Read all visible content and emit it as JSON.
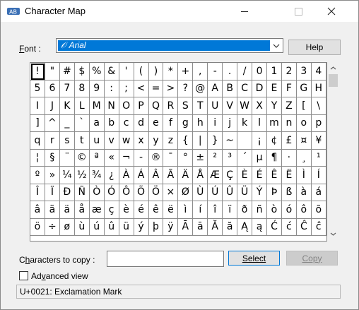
{
  "window": {
    "title": "Character Map",
    "buttons": [
      "minimize",
      "maximize",
      "close"
    ]
  },
  "font": {
    "label": "Font :",
    "selected": "Arial",
    "help_label": "Help"
  },
  "grid": {
    "selected_char": "!",
    "cells": [
      "!",
      "\"",
      "#",
      "$",
      "%",
      "&",
      "'",
      "(",
      ")",
      "*",
      "+",
      ",",
      "-",
      ".",
      "/",
      "0",
      "1",
      "2",
      "3",
      "4",
      "5",
      "6",
      "7",
      "8",
      "9",
      ":",
      ";",
      "<",
      "=",
      ">",
      "?",
      "@",
      "A",
      "B",
      "C",
      "D",
      "E",
      "F",
      "G",
      "H",
      "I",
      "J",
      "K",
      "L",
      "M",
      "N",
      "O",
      "P",
      "Q",
      "R",
      "S",
      "T",
      "U",
      "V",
      "W",
      "X",
      "Y",
      "Z",
      "[",
      "\\",
      "]",
      "^",
      "_",
      "`",
      "a",
      "b",
      "c",
      "d",
      "e",
      "f",
      "g",
      "h",
      "i",
      "j",
      "k",
      "l",
      "m",
      "n",
      "o",
      "p",
      "q",
      "r",
      "s",
      "t",
      "u",
      "v",
      "w",
      "x",
      "y",
      "z",
      "{",
      "|",
      "}",
      "~",
      " ",
      "¡",
      "¢",
      "£",
      "¤",
      "¥",
      "¦",
      "§",
      "¨",
      "©",
      "ª",
      "«",
      "¬",
      "-",
      "®",
      "¯",
      "°",
      "±",
      "²",
      "³",
      "´",
      "µ",
      "¶",
      "·",
      "¸",
      "¹",
      "º",
      "»",
      "¼",
      "½",
      "¾",
      "¿",
      "À",
      "Á",
      "Â",
      "Ã",
      "Ä",
      "Å",
      "Æ",
      "Ç",
      "È",
      "É",
      "Ê",
      "Ë",
      "Ì",
      "Í",
      "Î",
      "Ï",
      "Ð",
      "Ñ",
      "Ò",
      "Ó",
      "Ô",
      "Õ",
      "Ö",
      "×",
      "Ø",
      "Ù",
      "Ú",
      "Û",
      "Ü",
      "Ý",
      "Þ",
      "ß",
      "à",
      "á",
      "â",
      "ã",
      "ä",
      "å",
      "æ",
      "ç",
      "è",
      "é",
      "ê",
      "ë",
      "ì",
      "í",
      "î",
      "ï",
      "ð",
      "ñ",
      "ò",
      "ó",
      "ô",
      "õ",
      "ö",
      "÷",
      "ø",
      "ù",
      "ú",
      "û",
      "ü",
      "ý",
      "þ",
      "ÿ",
      "Ā",
      "ā",
      "Ă",
      "ă",
      "Ą",
      "ą",
      "Ć",
      "ć",
      "Ĉ",
      "ĉ"
    ]
  },
  "copy": {
    "label": "Characters to copy :",
    "value": "",
    "select_label": "Select",
    "copy_label": "Copy"
  },
  "advanced": {
    "label": "Advanced view",
    "checked": false
  },
  "status": "U+0021: Exclamation Mark"
}
